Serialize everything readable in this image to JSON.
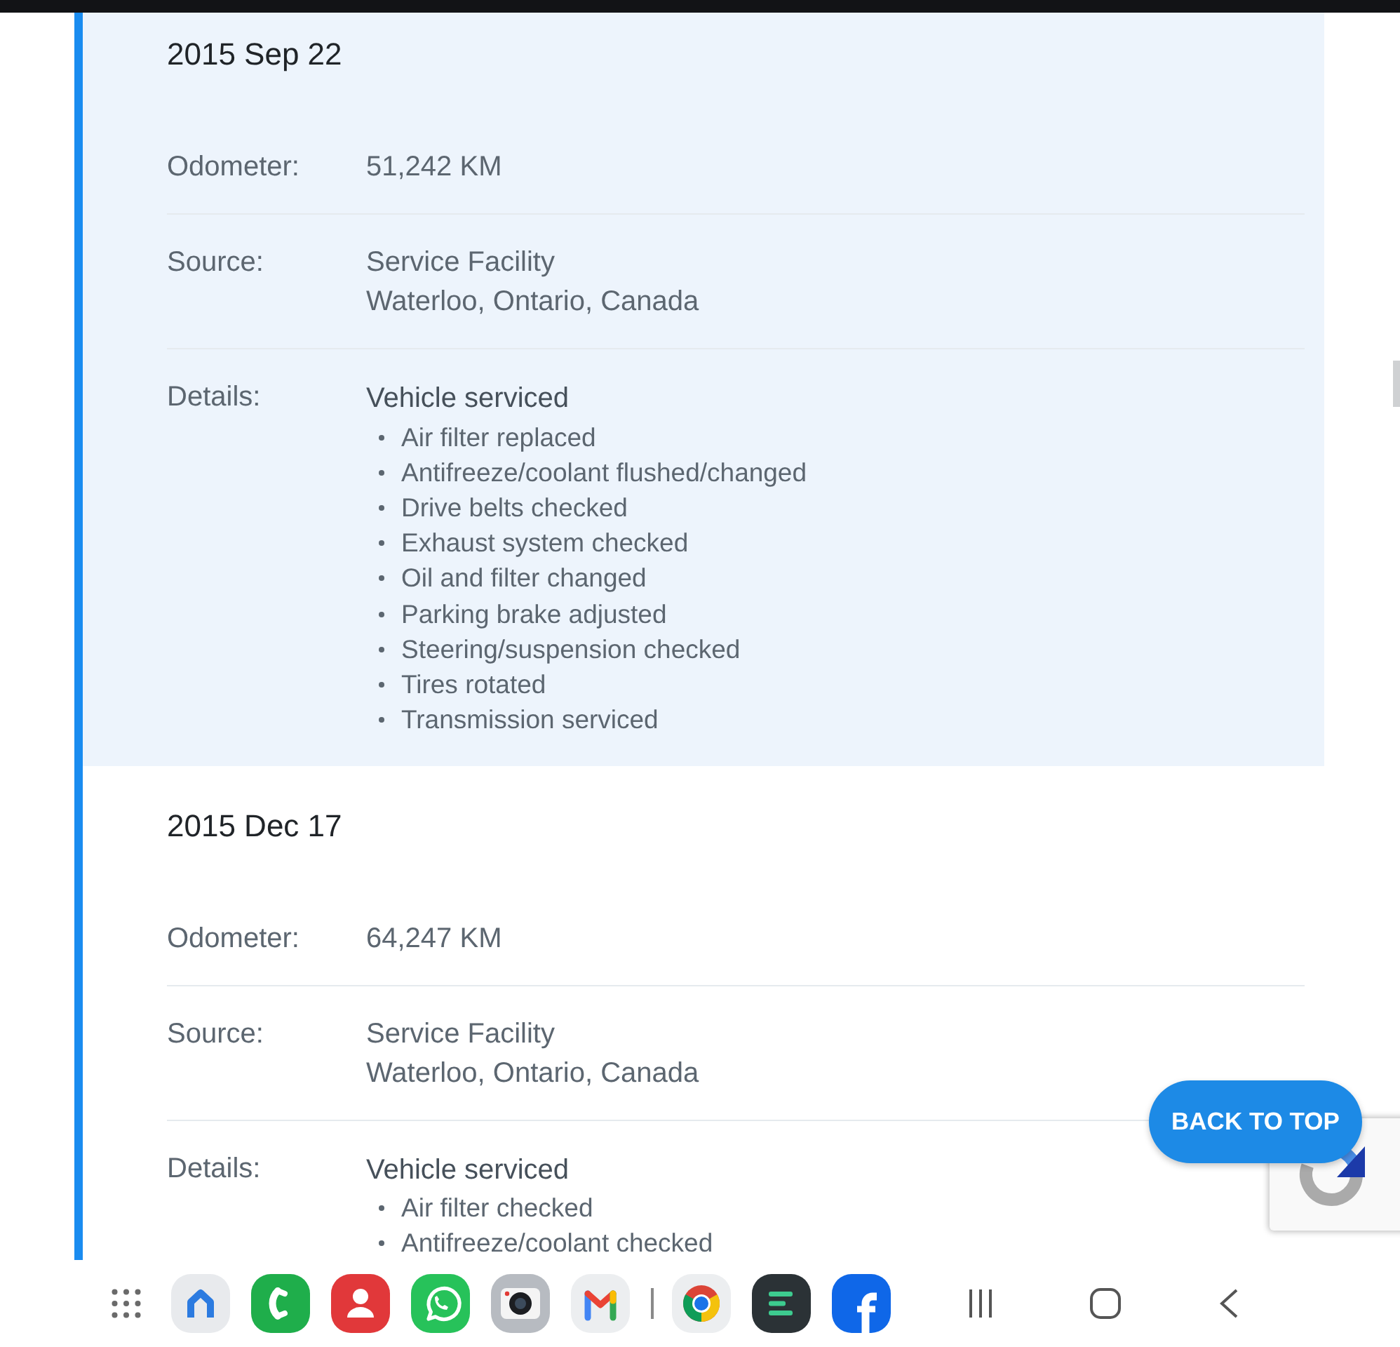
{
  "records": [
    {
      "date": "2015 Sep 22",
      "selected": true,
      "fields": [
        {
          "kind": "text",
          "label": "Odometer:",
          "lines": [
            "51,242 KM"
          ]
        },
        {
          "kind": "text",
          "label": "Source:",
          "lines": [
            "Service Facility",
            "Waterloo, Ontario, Canada"
          ]
        },
        {
          "kind": "list",
          "label": "Details:",
          "title": "Vehicle serviced",
          "items": [
            "Air filter replaced",
            "Antifreeze/coolant flushed/changed",
            "Drive belts checked",
            "Exhaust system checked",
            "Oil and filter changed",
            "Parking brake adjusted",
            "Steering/suspension checked",
            "Tires rotated",
            "Transmission serviced"
          ]
        }
      ]
    },
    {
      "date": "2015 Dec 17",
      "selected": false,
      "fields": [
        {
          "kind": "text",
          "label": "Odometer:",
          "lines": [
            "64,247 KM"
          ]
        },
        {
          "kind": "text",
          "label": "Source:",
          "lines": [
            "Service Facility",
            "Waterloo, Ontario, Canada"
          ]
        },
        {
          "kind": "list",
          "label": "Details:",
          "title": "Vehicle serviced",
          "items": [
            "Air filter checked",
            "Antifreeze/coolant checked"
          ]
        }
      ]
    }
  ],
  "back_to_top": {
    "label": "BACK TO TOP"
  }
}
